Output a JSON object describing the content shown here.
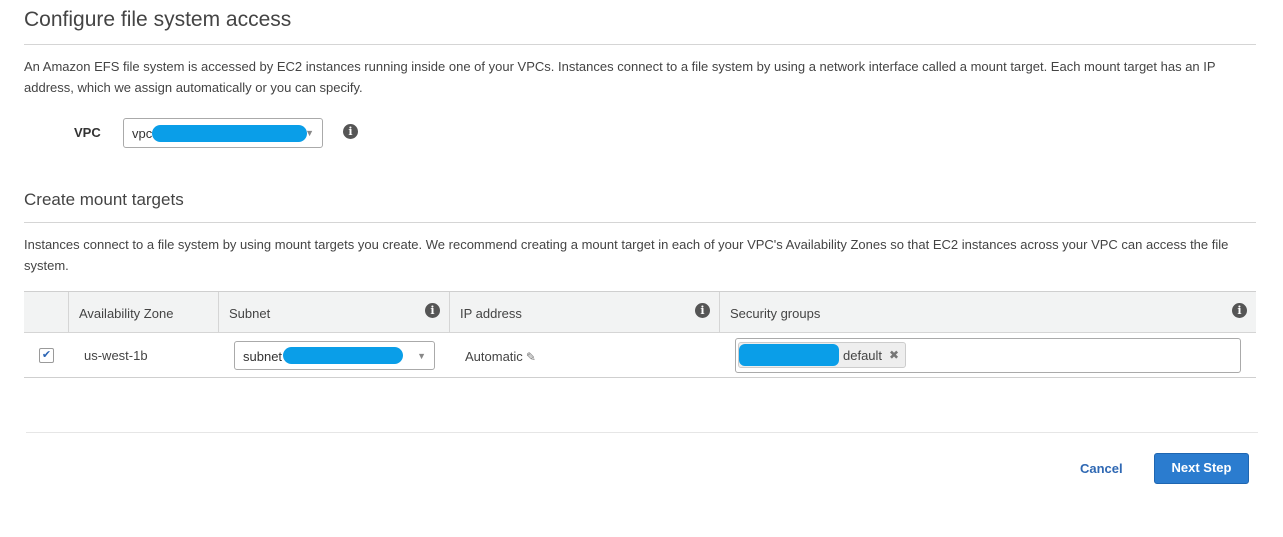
{
  "access": {
    "title": "Configure file system access",
    "description": "An Amazon EFS file system is accessed by EC2 instances running inside one of your VPCs. Instances connect to a file system by using a network interface called a mount target. Each mount target has an IP address, which we assign automatically or you can specify.",
    "vpc_label": "VPC",
    "vpc_value": "vpc"
  },
  "mount_targets": {
    "title": "Create mount targets",
    "description": "Instances connect to a file system by using mount targets you create. We recommend creating a mount target in each of your VPC's Availability Zones so that EC2 instances across your VPC can access the file system.",
    "columns": {
      "availability_zone": "Availability Zone",
      "subnet": "Subnet",
      "ip_address": "IP address",
      "security_groups": "Security groups"
    },
    "rows": [
      {
        "checked": true,
        "availability_zone": "us-west-1b",
        "subnet": "subnet",
        "ip_address": "Automatic",
        "security_group_token": "default"
      }
    ]
  },
  "footer": {
    "cancel_label": "Cancel",
    "next_label": "Next Step"
  },
  "colors": {
    "primary_button": "#2b7ccf",
    "link": "#2f68b3",
    "redaction": "#0a9ee8"
  },
  "icons": {
    "info": "info-icon",
    "caret": "chevron-down-icon",
    "pencil": "pencil-icon",
    "check": "checkmark-icon",
    "remove": "close-icon"
  }
}
